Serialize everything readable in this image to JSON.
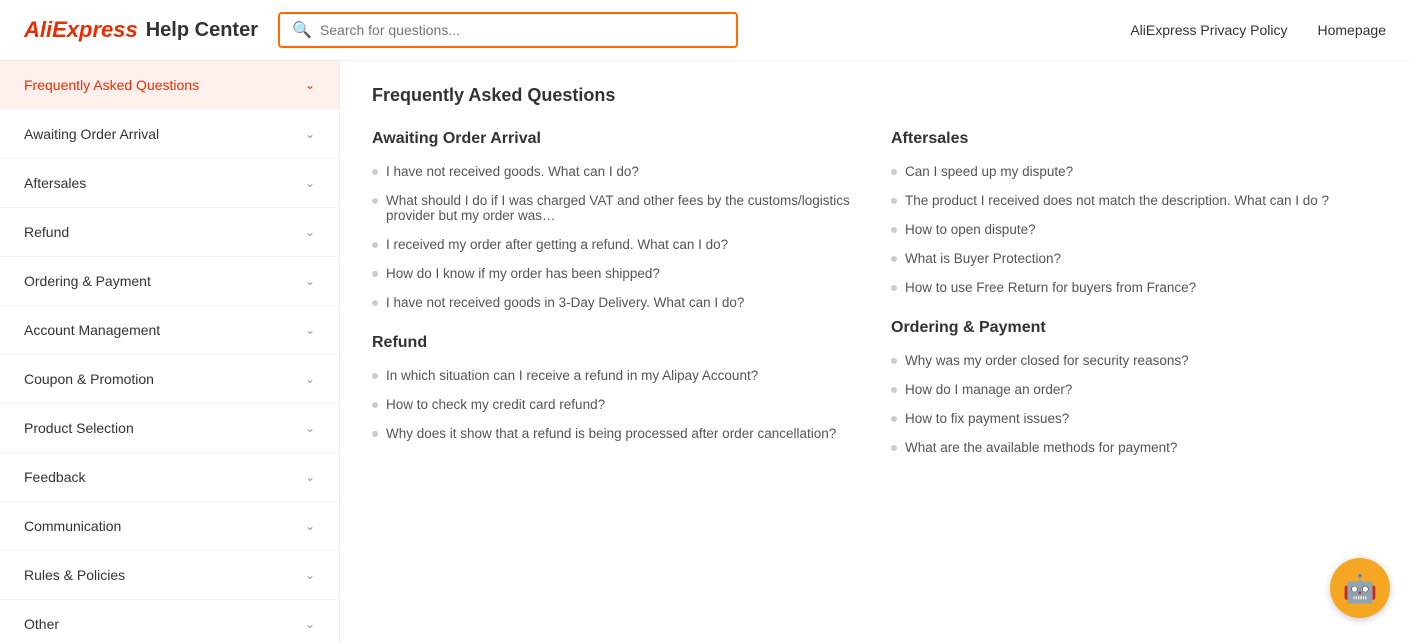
{
  "header": {
    "logo_main": "AliExpress",
    "logo_sub": "Help Center",
    "search_placeholder": "Search for questions...",
    "links": [
      {
        "label": "AliExpress Privacy Policy"
      },
      {
        "label": "Homepage"
      }
    ]
  },
  "sidebar": {
    "items": [
      {
        "label": "Frequently Asked Questions",
        "active": true
      },
      {
        "label": "Awaiting Order Arrival",
        "active": false
      },
      {
        "label": "Aftersales",
        "active": false
      },
      {
        "label": "Refund",
        "active": false
      },
      {
        "label": "Ordering & Payment",
        "active": false
      },
      {
        "label": "Account Management",
        "active": false
      },
      {
        "label": "Coupon & Promotion",
        "active": false
      },
      {
        "label": "Product Selection",
        "active": false
      },
      {
        "label": "Feedback",
        "active": false
      },
      {
        "label": "Communication",
        "active": false
      },
      {
        "label": "Rules & Policies",
        "active": false
      },
      {
        "label": "Other",
        "active": false
      }
    ]
  },
  "content": {
    "page_title": "Frequently Asked Questions",
    "sections": [
      {
        "id": "awaiting-order-arrival",
        "title": "Awaiting Order Arrival",
        "questions": [
          "I have not received goods. What can I do?",
          "What should I do if I was charged VAT and other fees by the customs/logistics provider but my order was…",
          "I received my order after getting a refund. What can I do?",
          "How do I know if my order has been shipped?",
          "I have not received goods in 3-Day Delivery. What can I do?"
        ]
      },
      {
        "id": "aftersales",
        "title": "Aftersales",
        "questions": [
          "Can I speed up my dispute?",
          "The product I received does not match the description. What can I do ?",
          "How to open dispute?",
          "What is Buyer Protection?",
          "How to use Free Return for buyers from France?"
        ]
      },
      {
        "id": "refund",
        "title": "Refund",
        "questions": [
          "In which situation can I receive a refund in my Alipay Account?",
          "How to check my credit card refund?",
          "Why does it show that a refund is being processed after order cancellation?"
        ]
      },
      {
        "id": "ordering-payment",
        "title": "Ordering & Payment",
        "questions": [
          "Why was my order closed for security reasons?",
          "How do I manage an order?",
          "How to fix payment issues?",
          "What are the available methods for payment?"
        ]
      }
    ]
  }
}
